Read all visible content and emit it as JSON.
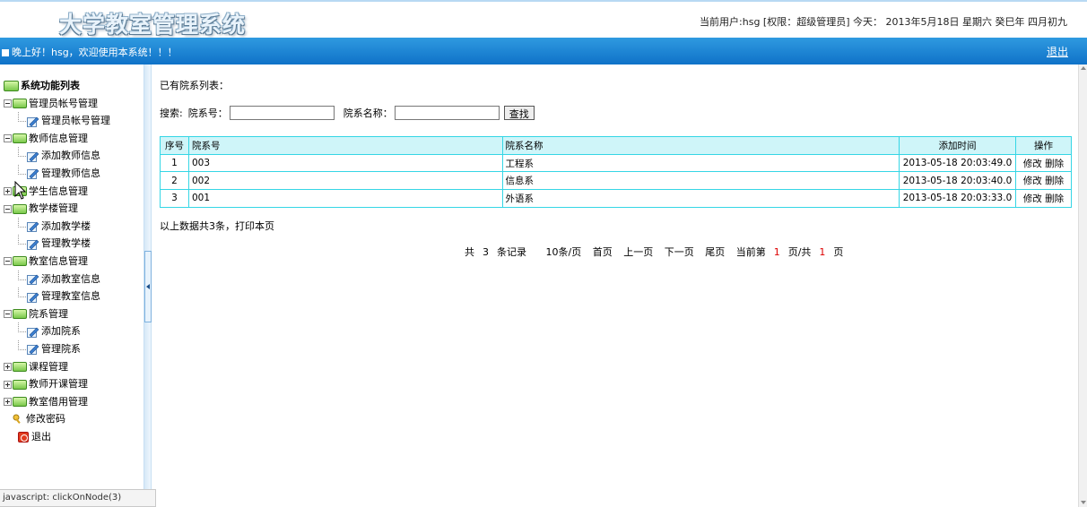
{
  "header": {
    "logo": "大学教室管理系统",
    "user_info": "当前用户:hsg [权限：超级管理员] 今天： 2013年5月18日 星期六 癸巳年 四月初九"
  },
  "topbar": {
    "greeting": "晚上好！hsg，欢迎使用本系统！！！",
    "logout": "退出"
  },
  "sidebar": {
    "root": "系统功能列表",
    "items": [
      {
        "label": "管理员帐号管理"
      },
      {
        "label": "管理员帐号管理"
      },
      {
        "label": "教师信息管理"
      },
      {
        "label": "添加教师信息"
      },
      {
        "label": "管理教师信息"
      },
      {
        "label": "学生信息管理"
      },
      {
        "label": "教学楼管理"
      },
      {
        "label": "添加教学楼"
      },
      {
        "label": "管理教学楼"
      },
      {
        "label": "教室信息管理"
      },
      {
        "label": "添加教室信息"
      },
      {
        "label": "管理教室信息"
      },
      {
        "label": "院系管理"
      },
      {
        "label": "添加院系"
      },
      {
        "label": "管理院系"
      },
      {
        "label": "课程管理"
      },
      {
        "label": "教师开课管理"
      },
      {
        "label": "教室借用管理"
      },
      {
        "label": "修改密码"
      },
      {
        "label": "退出"
      }
    ]
  },
  "status_bar": "javascript: clickOnNode(3)",
  "main": {
    "title": "已有院系列表：",
    "search": {
      "label": "搜索:",
      "id_label": "院系号：",
      "id_value": "",
      "name_label": "院系名称：",
      "name_value": "",
      "button": "查找"
    },
    "table": {
      "headers": [
        "序号",
        "院系号",
        "院系名称",
        "添加时间",
        "操作"
      ],
      "rows": [
        {
          "seq": "1",
          "id": "003",
          "name": "工程系",
          "time": "2013-05-18 20:03:49.0",
          "edit": "修改",
          "del": "删除"
        },
        {
          "seq": "2",
          "id": "002",
          "name": "信息系",
          "time": "2013-05-18 20:03:40.0",
          "edit": "修改",
          "del": "删除"
        },
        {
          "seq": "3",
          "id": "001",
          "name": "外语系",
          "time": "2013-05-18 20:03:33.0",
          "edit": "修改",
          "del": "删除"
        }
      ]
    },
    "summary": "以上数据共3条，打印本页",
    "pager": {
      "total_pre": "共",
      "total": "3",
      "total_post": "条记录",
      "per_page": "10条/页",
      "first": "首页",
      "prev": "上一页",
      "next": "下一页",
      "last": "尾页",
      "cur_pre": "当前第",
      "cur": "1",
      "cur_mid": "页/共",
      "pages": "1",
      "cur_post": "页"
    }
  },
  "colors": {
    "bar": "#1583d3",
    "table_border": "#35d6e5",
    "table_header": "#cff5f9"
  }
}
